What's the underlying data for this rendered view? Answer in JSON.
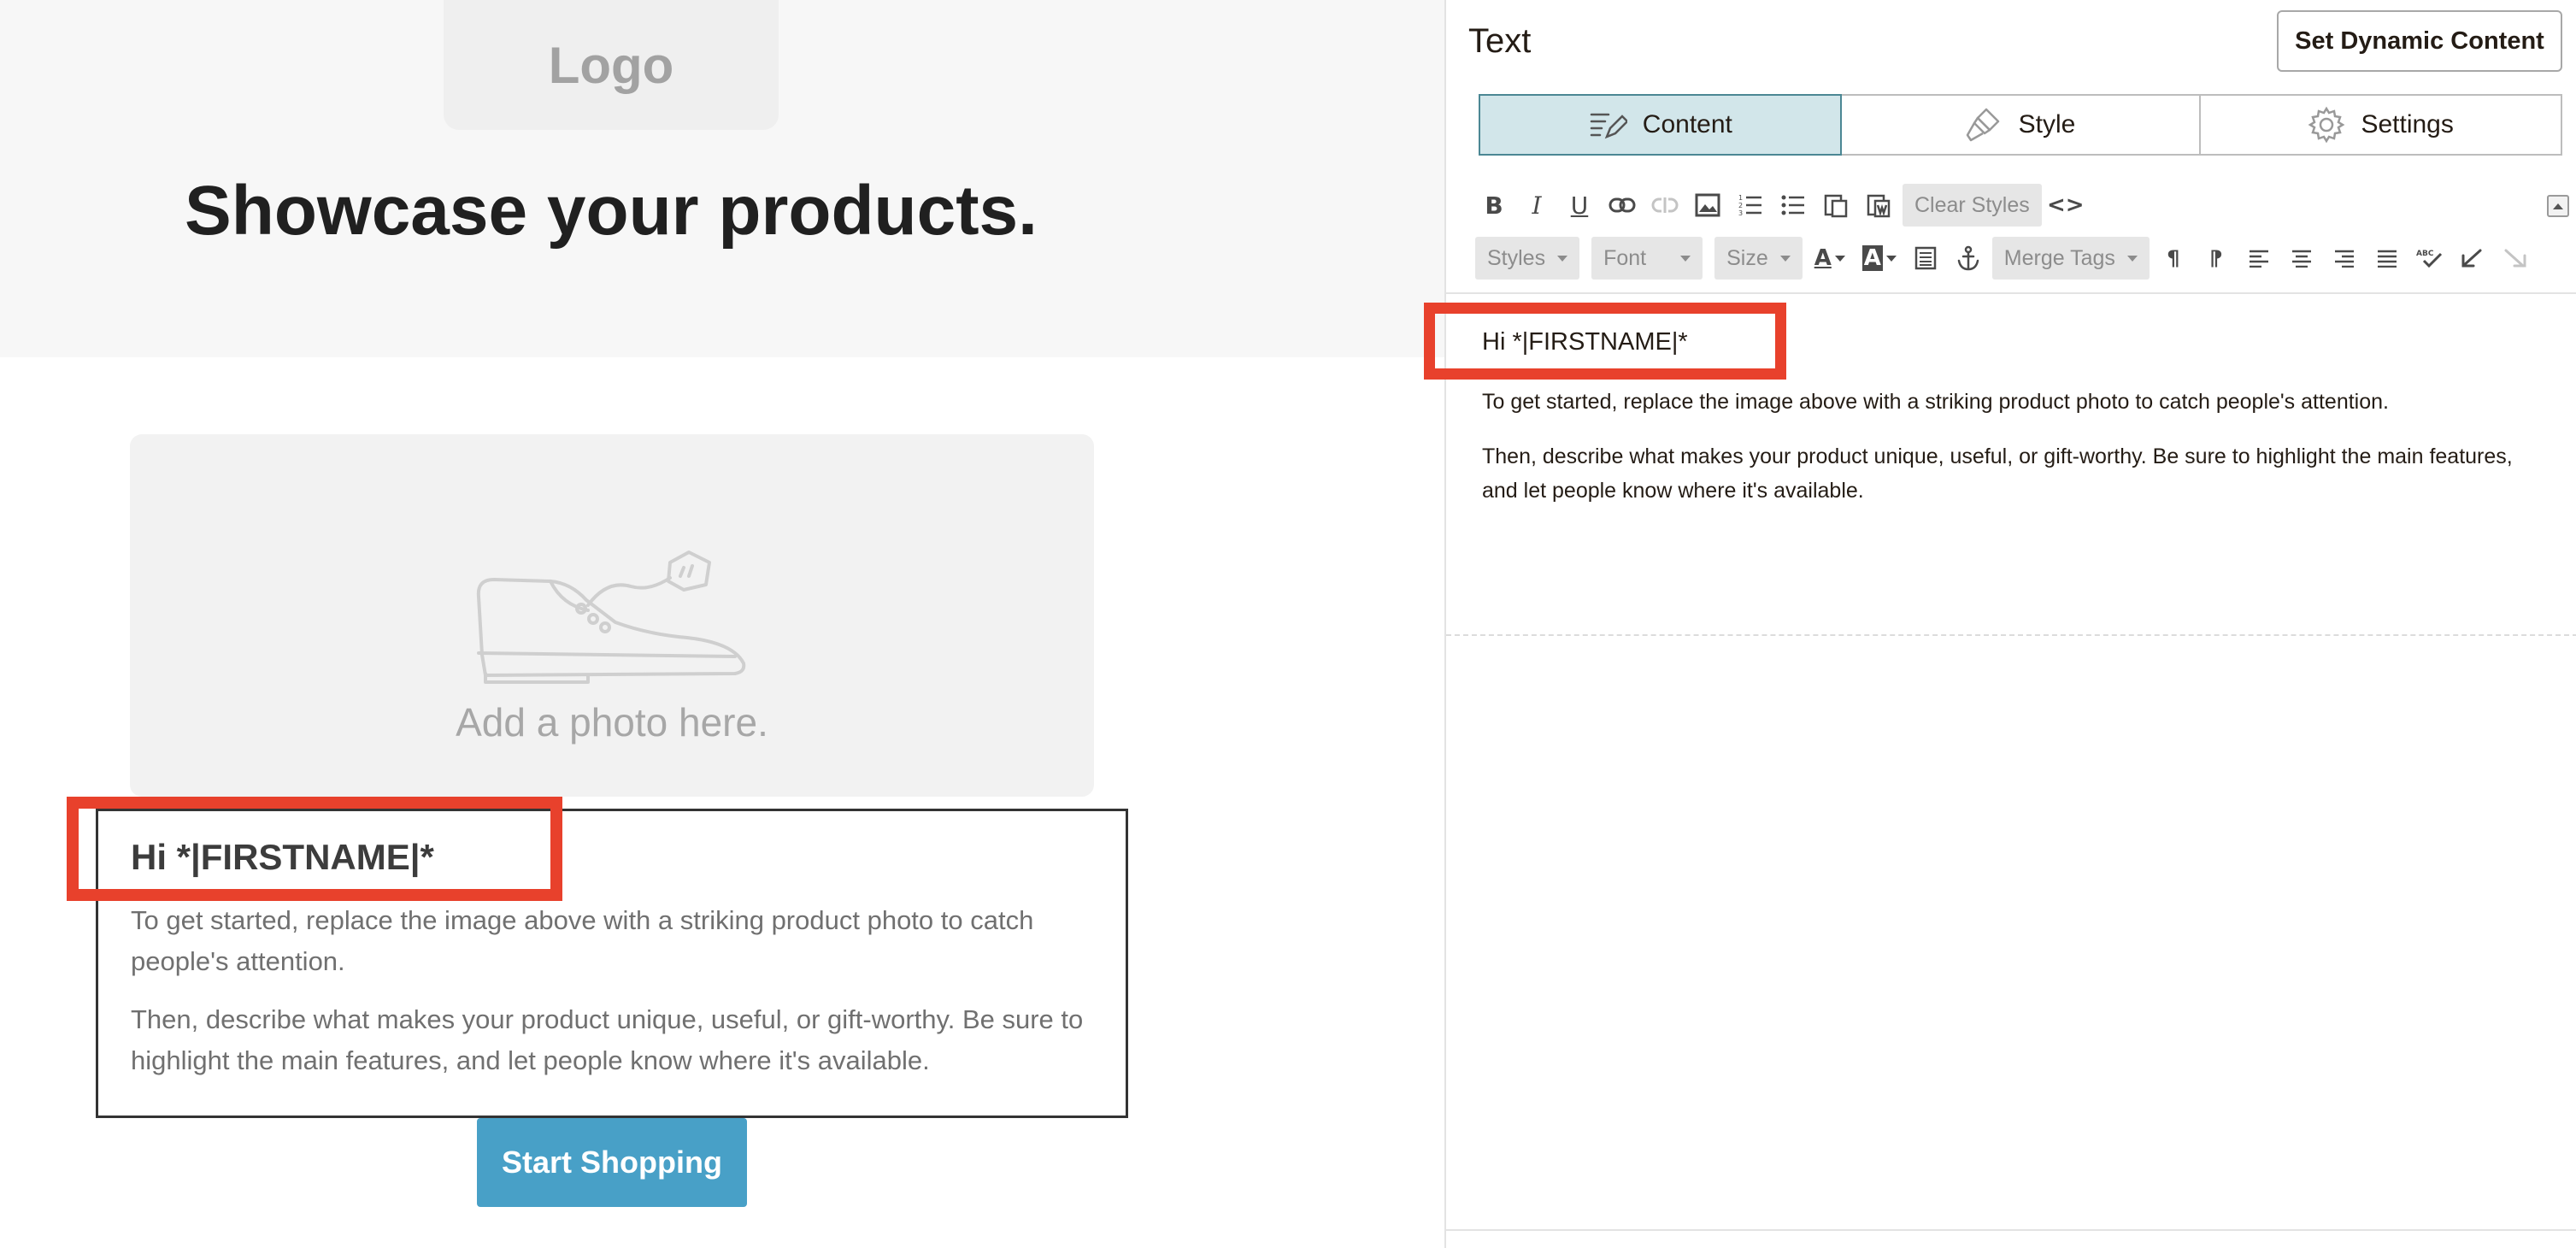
{
  "canvas": {
    "logo": "Logo",
    "hero_title": "Showcase your products.",
    "photo_placeholder": "Add a photo here.",
    "heading": "Hi *|FIRSTNAME|*",
    "paragraphs": [
      "To get started, replace the image above with a striking product photo to catch people's attention.",
      "Then, describe what makes your product unique, useful, or gift-worthy. Be sure to highlight the main features, and let people know where it's available."
    ],
    "button_label": "Start Shopping"
  },
  "panel": {
    "title": "Text",
    "dynamic_button": "Set Dynamic Content",
    "tabs": [
      {
        "label": "Content",
        "icon": "content-pencil-icon",
        "active": true
      },
      {
        "label": "Style",
        "icon": "style-brush-icon",
        "active": false
      },
      {
        "label": "Settings",
        "icon": "settings-gear-icon",
        "active": false
      }
    ],
    "toolbar": {
      "clear_styles": "Clear Styles",
      "styles": "Styles",
      "font": "Font",
      "size": "Size",
      "merge_tags": "Merge Tags"
    },
    "editor": {
      "heading": "Hi *|FIRSTNAME|*",
      "paragraphs": [
        "To get started, replace the image above with a striking product photo to catch people's attention.",
        "Then, describe what makes your product unique, useful, or gift-worthy. Be sure to highlight the main features, and let people know where it's available."
      ]
    }
  },
  "colors": {
    "highlight": "#e8412c",
    "button": "#48a0c7",
    "active_tab": "#d2e6ea"
  }
}
